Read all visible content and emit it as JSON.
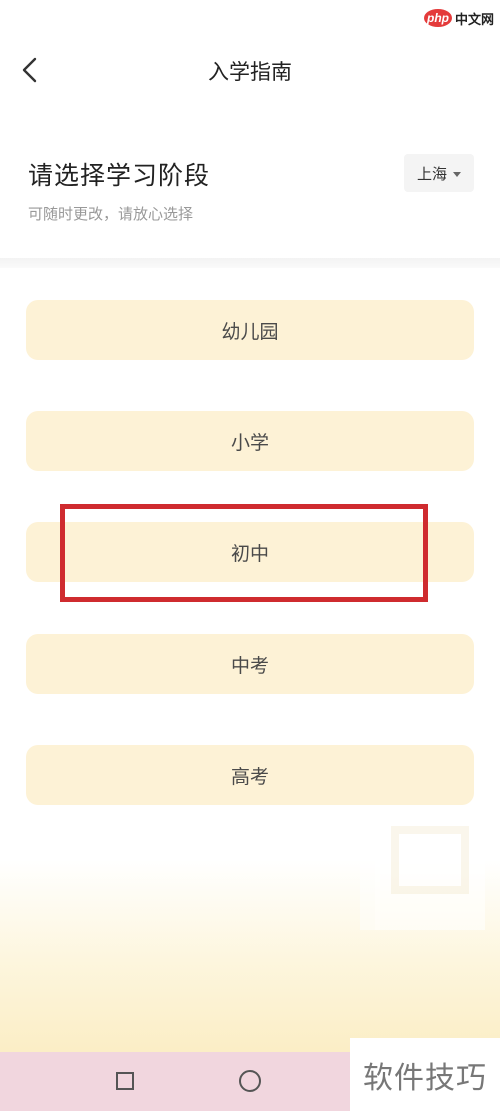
{
  "watermark": {
    "php": "php",
    "site": "中文网",
    "bottom": "软件技巧"
  },
  "header": {
    "title": "入学指南",
    "back_icon": "chevron-left-icon"
  },
  "section": {
    "title": "请选择学习阶段",
    "subtitle": "可随时更改，请放心选择",
    "city": "上海"
  },
  "stages": [
    {
      "label": "幼儿园"
    },
    {
      "label": "小学"
    },
    {
      "label": "初中"
    },
    {
      "label": "中考"
    },
    {
      "label": "高考"
    }
  ],
  "highlighted_stage": "初中",
  "colors": {
    "stage_bg": "#fdf2d6",
    "highlight": "#cf2b2f",
    "navbar": "#f1d6de"
  },
  "navbar": {
    "icons": [
      "square-icon",
      "circle-icon"
    ]
  }
}
